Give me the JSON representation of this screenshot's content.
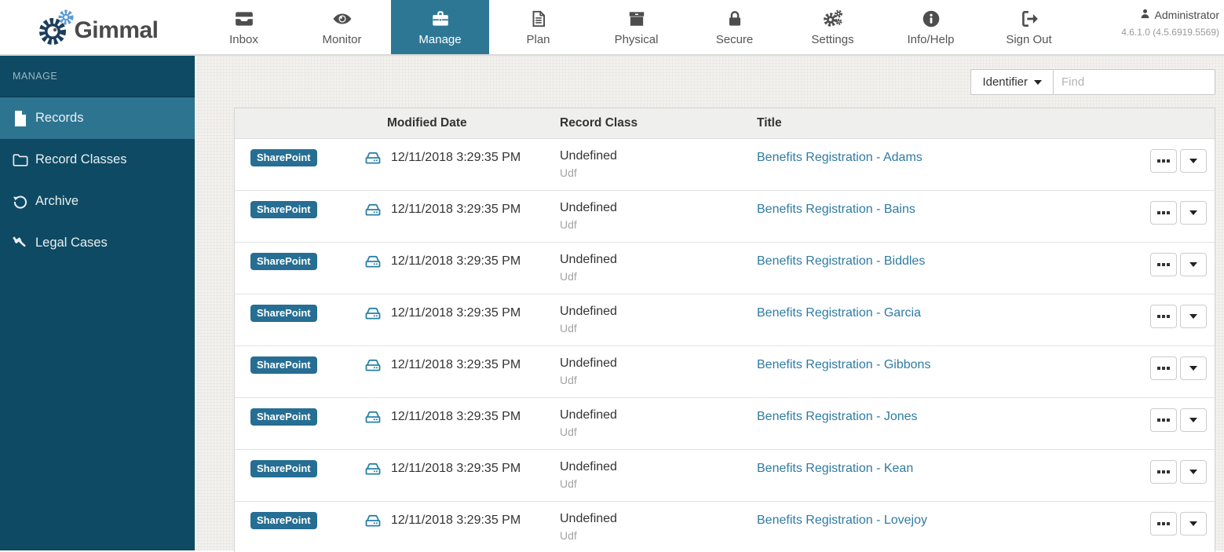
{
  "app": {
    "brand": "Gimmal",
    "user": "Administrator",
    "version": "4.6.1.0 (4.5.6919.5569)"
  },
  "nav": {
    "items": [
      {
        "label": "Inbox",
        "icon": "inbox-icon"
      },
      {
        "label": "Monitor",
        "icon": "eye-icon"
      },
      {
        "label": "Manage",
        "icon": "briefcase-icon",
        "active": true
      },
      {
        "label": "Plan",
        "icon": "document-icon"
      },
      {
        "label": "Physical",
        "icon": "box-icon"
      },
      {
        "label": "Secure",
        "icon": "lock-icon"
      },
      {
        "label": "Settings",
        "icon": "gears-icon"
      },
      {
        "label": "Info/Help",
        "icon": "info-icon"
      },
      {
        "label": "Sign Out",
        "icon": "sign-out-icon"
      }
    ]
  },
  "sidebar": {
    "section_label": "MANAGE",
    "items": [
      {
        "label": "Records",
        "icon": "file-icon",
        "active": true
      },
      {
        "label": "Record Classes",
        "icon": "folder-icon"
      },
      {
        "label": "Archive",
        "icon": "history-icon"
      },
      {
        "label": "Legal Cases",
        "icon": "gavel-icon"
      }
    ]
  },
  "toolbar": {
    "filter_button_label": "Identifier",
    "find_placeholder": "Find"
  },
  "table": {
    "columns": {
      "modified_date": "Modified Date",
      "record_class": "Record Class",
      "title": "Title"
    },
    "rows": [
      {
        "source": "SharePoint",
        "modified_date": "12/11/2018 3:29:35 PM",
        "record_class": "Undefined",
        "record_class_detail": "Udf",
        "title": "Benefits Registration - Adams"
      },
      {
        "source": "SharePoint",
        "modified_date": "12/11/2018 3:29:35 PM",
        "record_class": "Undefined",
        "record_class_detail": "Udf",
        "title": "Benefits Registration - Bains"
      },
      {
        "source": "SharePoint",
        "modified_date": "12/11/2018 3:29:35 PM",
        "record_class": "Undefined",
        "record_class_detail": "Udf",
        "title": "Benefits Registration - Biddles"
      },
      {
        "source": "SharePoint",
        "modified_date": "12/11/2018 3:29:35 PM",
        "record_class": "Undefined",
        "record_class_detail": "Udf",
        "title": "Benefits Registration - Garcia"
      },
      {
        "source": "SharePoint",
        "modified_date": "12/11/2018 3:29:35 PM",
        "record_class": "Undefined",
        "record_class_detail": "Udf",
        "title": "Benefits Registration - Gibbons"
      },
      {
        "source": "SharePoint",
        "modified_date": "12/11/2018 3:29:35 PM",
        "record_class": "Undefined",
        "record_class_detail": "Udf",
        "title": "Benefits Registration - Jones"
      },
      {
        "source": "SharePoint",
        "modified_date": "12/11/2018 3:29:35 PM",
        "record_class": "Undefined",
        "record_class_detail": "Udf",
        "title": "Benefits Registration - Kean"
      },
      {
        "source": "SharePoint",
        "modified_date": "12/11/2018 3:29:35 PM",
        "record_class": "Undefined",
        "record_class_detail": "Udf",
        "title": "Benefits Registration - Lovejoy"
      }
    ]
  },
  "colors": {
    "accent_teal": "#2d7795",
    "sidebar_bg": "#0e4a63",
    "sidebar_active": "#2d7491",
    "badge_bg": "#266e93",
    "link": "#2e7ba3",
    "hdd_icon": "#2980a5"
  }
}
